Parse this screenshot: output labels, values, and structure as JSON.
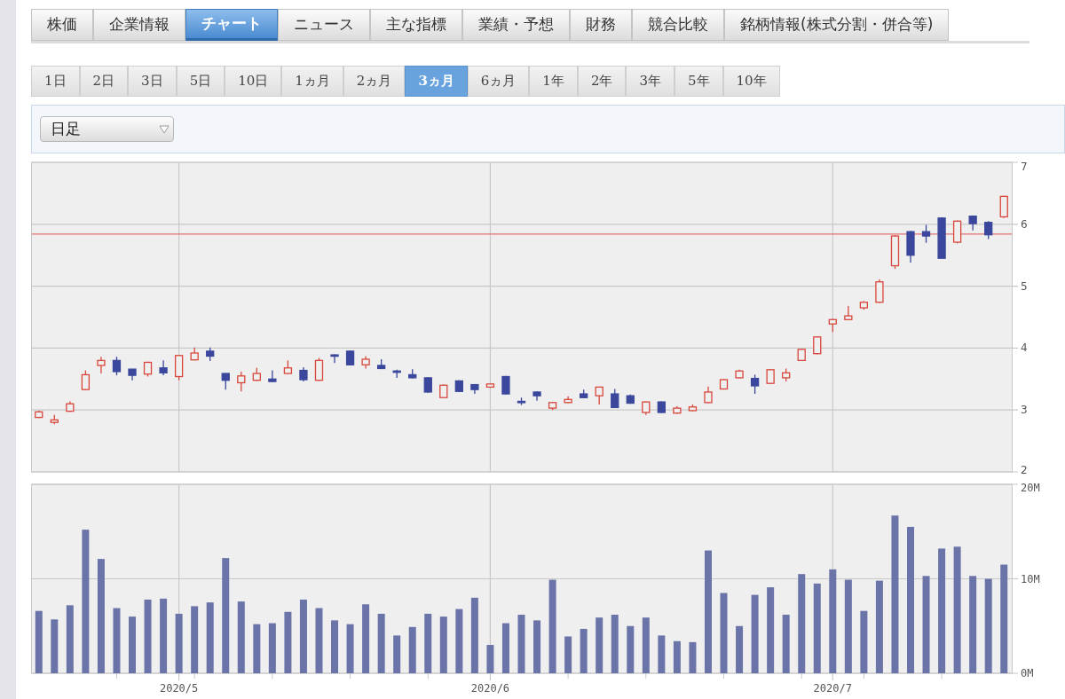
{
  "tabs": [
    {
      "label": "株価",
      "selected": false
    },
    {
      "label": "企業情報",
      "selected": false
    },
    {
      "label": "チャート",
      "selected": true
    },
    {
      "label": "ニュース",
      "selected": false
    },
    {
      "label": "主な指標",
      "selected": false
    },
    {
      "label": "業績・予想",
      "selected": false
    },
    {
      "label": "財務",
      "selected": false
    },
    {
      "label": "競合比較",
      "selected": false
    },
    {
      "label": "銘柄情報(株式分割・併合等)",
      "selected": false
    }
  ],
  "periods": [
    {
      "label": "1日",
      "selected": false
    },
    {
      "label": "2日",
      "selected": false
    },
    {
      "label": "3日",
      "selected": false
    },
    {
      "label": "5日",
      "selected": false
    },
    {
      "label": "10日",
      "selected": false
    },
    {
      "label": "1ヵ月",
      "selected": false
    },
    {
      "label": "2ヵ月",
      "selected": false
    },
    {
      "label": "3ヵ月",
      "selected": true
    },
    {
      "label": "6ヵ月",
      "selected": false
    },
    {
      "label": "1年",
      "selected": false
    },
    {
      "label": "2年",
      "selected": false
    },
    {
      "label": "3年",
      "selected": false
    },
    {
      "label": "5年",
      "selected": false
    },
    {
      "label": "10年",
      "selected": false
    }
  ],
  "interval_select": {
    "value": "日足"
  },
  "price_chart": {
    "chart_data": {
      "type": "candlestick",
      "grid": true,
      "categories": [
        null,
        null,
        null,
        null,
        null,
        null,
        null,
        null,
        null,
        null,
        null,
        null,
        null,
        null,
        null,
        null,
        null,
        null,
        null,
        null,
        null,
        null,
        null,
        null,
        null,
        null,
        null,
        null,
        null,
        null,
        null,
        null,
        null,
        null,
        null,
        null,
        null,
        null,
        null,
        null,
        null,
        null,
        null,
        null,
        null,
        null,
        null,
        null,
        null,
        null,
        null,
        null,
        null,
        null,
        null,
        null,
        null,
        null,
        null,
        null,
        null,
        null,
        null
      ],
      "ylim": [
        2,
        7
      ],
      "yticks": [
        2,
        3,
        4,
        5,
        6,
        7
      ],
      "ref_lines": [
        {
          "axis": "y",
          "value": 5.84
        }
      ],
      "ohlc": [
        [
          2.88,
          2.99,
          2.87,
          2.97
        ],
        [
          2.8,
          2.92,
          2.77,
          2.84
        ],
        [
          2.98,
          3.14,
          2.97,
          3.1
        ],
        [
          3.33,
          3.64,
          3.32,
          3.57
        ],
        [
          3.72,
          3.86,
          3.59,
          3.8
        ],
        [
          3.8,
          3.86,
          3.56,
          3.62
        ],
        [
          3.66,
          3.66,
          3.48,
          3.56
        ],
        [
          3.58,
          3.78,
          3.54,
          3.77
        ],
        [
          3.68,
          3.8,
          3.56,
          3.6
        ],
        [
          3.54,
          3.89,
          3.48,
          3.88
        ],
        [
          3.81,
          4.01,
          3.8,
          3.92
        ],
        [
          3.95,
          4.01,
          3.79,
          3.87
        ],
        [
          3.59,
          3.59,
          3.33,
          3.48
        ],
        [
          3.44,
          3.62,
          3.3,
          3.55
        ],
        [
          3.48,
          3.68,
          3.47,
          3.59
        ],
        [
          3.5,
          3.64,
          3.45,
          3.46
        ],
        [
          3.59,
          3.8,
          3.58,
          3.68
        ],
        [
          3.64,
          3.69,
          3.46,
          3.49
        ],
        [
          3.48,
          3.84,
          3.47,
          3.8
        ],
        [
          3.89,
          3.9,
          3.76,
          3.88
        ],
        [
          3.95,
          3.96,
          3.72,
          3.73
        ],
        [
          3.73,
          3.87,
          3.67,
          3.82
        ],
        [
          3.72,
          3.82,
          3.66,
          3.67
        ],
        [
          3.63,
          3.65,
          3.52,
          3.62
        ],
        [
          3.57,
          3.66,
          3.51,
          3.52
        ],
        [
          3.52,
          3.53,
          3.28,
          3.29
        ],
        [
          3.2,
          3.41,
          3.19,
          3.4
        ],
        [
          3.47,
          3.48,
          3.29,
          3.3
        ],
        [
          3.41,
          3.42,
          3.26,
          3.33
        ],
        [
          3.37,
          3.43,
          3.36,
          3.42
        ],
        [
          3.54,
          3.55,
          3.25,
          3.26
        ],
        [
          3.14,
          3.2,
          3.08,
          3.13
        ],
        [
          3.29,
          3.3,
          3.15,
          3.23
        ],
        [
          3.03,
          3.13,
          3.0,
          3.12
        ],
        [
          3.12,
          3.22,
          3.11,
          3.17
        ],
        [
          3.26,
          3.33,
          3.19,
          3.2
        ],
        [
          3.23,
          3.37,
          3.09,
          3.37
        ],
        [
          3.26,
          3.34,
          3.03,
          3.04
        ],
        [
          3.23,
          3.25,
          3.1,
          3.11
        ],
        [
          2.96,
          3.14,
          2.92,
          3.13
        ],
        [
          3.13,
          3.14,
          2.95,
          2.96
        ],
        [
          2.95,
          3.06,
          2.94,
          3.03
        ],
        [
          2.99,
          3.09,
          2.98,
          3.05
        ],
        [
          3.12,
          3.38,
          3.11,
          3.29
        ],
        [
          3.34,
          3.5,
          3.33,
          3.49
        ],
        [
          3.52,
          3.65,
          3.51,
          3.63
        ],
        [
          3.51,
          3.57,
          3.26,
          3.39
        ],
        [
          3.43,
          3.66,
          3.42,
          3.65
        ],
        [
          3.52,
          3.67,
          3.46,
          3.6
        ],
        [
          3.8,
          3.99,
          3.79,
          3.98
        ],
        [
          3.91,
          4.19,
          3.9,
          4.18
        ],
        [
          4.39,
          4.47,
          4.26,
          4.46
        ],
        [
          4.46,
          4.68,
          4.45,
          4.52
        ],
        [
          4.65,
          4.76,
          4.62,
          4.74
        ],
        [
          4.74,
          5.11,
          4.73,
          5.07
        ],
        [
          5.33,
          5.82,
          5.28,
          5.81
        ],
        [
          5.88,
          5.89,
          5.38,
          5.5
        ],
        [
          5.88,
          5.99,
          5.7,
          5.81
        ],
        [
          6.1,
          6.11,
          5.45,
          5.45
        ],
        [
          5.71,
          6.06,
          5.69,
          6.05
        ],
        [
          6.13,
          6.14,
          5.9,
          6.01
        ],
        [
          6.03,
          6.05,
          5.76,
          5.83
        ],
        [
          6.12,
          6.46,
          6.1,
          6.45
        ]
      ]
    }
  },
  "volume_chart": {
    "chart_data": {
      "type": "bar",
      "grid": true,
      "ylim": [
        0,
        20
      ],
      "categories": [
        null,
        null,
        null,
        null,
        null,
        null,
        null,
        null,
        null,
        "2020/5",
        null,
        null,
        null,
        null,
        null,
        null,
        null,
        null,
        null,
        null,
        null,
        null,
        null,
        null,
        null,
        null,
        null,
        null,
        null,
        "2020/6",
        null,
        null,
        null,
        null,
        null,
        null,
        null,
        null,
        null,
        null,
        null,
        null,
        null,
        null,
        null,
        null,
        null,
        null,
        null,
        null,
        null,
        "2020/7",
        null,
        null,
        null,
        null,
        null,
        null,
        null,
        null,
        null,
        null,
        null
      ],
      "yticks": [
        {
          "value": 0,
          "label": "0M"
        },
        {
          "value": 10,
          "label": "10M"
        },
        {
          "value": 20,
          "label": "20M"
        }
      ],
      "series": [
        {
          "color": "#6b74a8",
          "values": [
            6.6,
            5.7,
            7.2,
            15.2,
            12.1,
            6.9,
            6.0,
            7.8,
            7.9,
            6.3,
            7.1,
            7.5,
            12.2,
            7.6,
            5.2,
            5.3,
            6.5,
            7.8,
            6.9,
            5.6,
            5.2,
            7.3,
            6.3,
            4.0,
            4.9,
            6.3,
            6.0,
            6.8,
            8.0,
            3.0,
            5.3,
            6.2,
            5.6,
            9.9,
            3.9,
            4.7,
            5.9,
            6.2,
            5.0,
            5.9,
            4.0,
            3.4,
            3.3,
            13.0,
            8.5,
            5.0,
            8.3,
            9.1,
            6.2,
            10.5,
            9.5,
            11.0,
            9.9,
            6.6,
            9.8,
            16.7,
            15.5,
            10.3,
            13.2,
            13.4,
            10.3,
            10.0,
            11.5
          ]
        }
      ]
    }
  }
}
